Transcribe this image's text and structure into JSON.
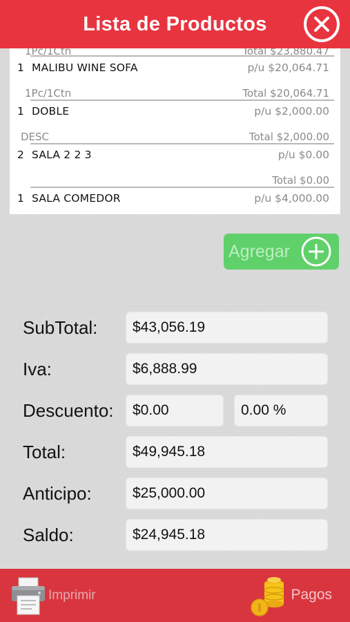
{
  "header": {
    "title": "Lista de Productos"
  },
  "products": {
    "partial_package": "1Pc/1Ctn",
    "partial_total": "Total $23,880.47",
    "items": [
      {
        "qty": "1",
        "name": "MALIBU WINE SOFA",
        "unit_price": "p/u $20,064.71",
        "package": "1Pc/1Ctn",
        "total": "Total $20,064.71"
      },
      {
        "qty": "1",
        "name": "DOBLE",
        "unit_price": "p/u $2,000.00",
        "package": "DESC",
        "total": "Total $2,000.00"
      },
      {
        "qty": "2",
        "name": "SALA 2 2 3",
        "unit_price": "p/u $0.00",
        "package": "",
        "total": "Total $0.00"
      },
      {
        "qty": "1",
        "name": "SALA COMEDOR",
        "unit_price": "p/u $4,000.00",
        "package": "",
        "total": ""
      }
    ]
  },
  "add_button": {
    "label": "Agregar"
  },
  "summary": {
    "subtotal": {
      "label": "SubTotal:",
      "value": "$43,056.19"
    },
    "iva": {
      "label": "Iva:",
      "value": "$6,888.99"
    },
    "descuento": {
      "label": "Descuento:",
      "value": "$0.00",
      "percent": "0.00 %"
    },
    "total": {
      "label": "Total:",
      "value": "$49,945.18"
    },
    "anticipo": {
      "label": "Anticipo:",
      "value": "$25,000.00"
    },
    "saldo": {
      "label": "Saldo:",
      "value": "$24,945.18"
    }
  },
  "footer": {
    "print_label": "Imprimir",
    "payments_label": "Pagos"
  },
  "colors": {
    "header": "#e8343f",
    "footer": "#d9353e",
    "add_button": "#5fd06a",
    "background": "#dcdcdc"
  }
}
